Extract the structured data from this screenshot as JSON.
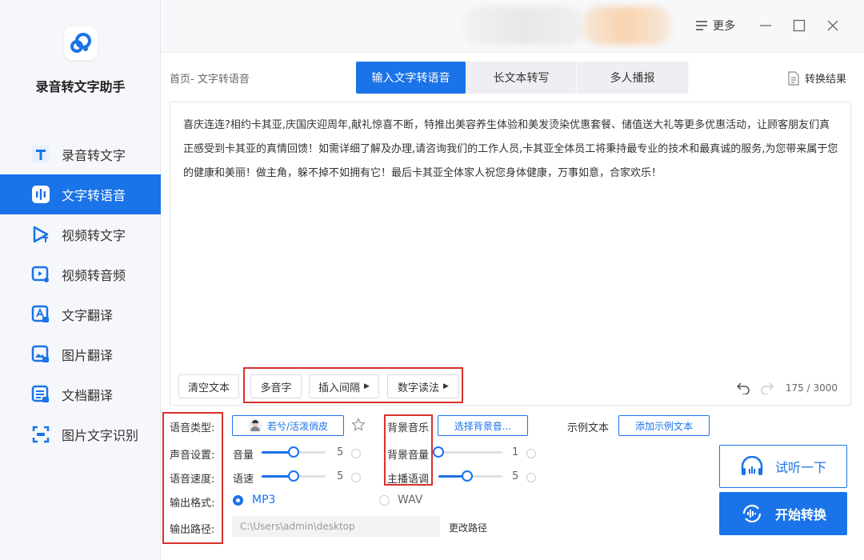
{
  "app": {
    "name": "录音转文字助手"
  },
  "sidebar": {
    "items": [
      {
        "label": "录音转文字",
        "icon": "text-t-icon"
      },
      {
        "label": "文字转语音",
        "icon": "audio-wave-icon",
        "active": true
      },
      {
        "label": "视频转文字",
        "icon": "video-play-icon"
      },
      {
        "label": "视频转音频",
        "icon": "video-audio-icon"
      },
      {
        "label": "文字翻译",
        "icon": "translate-text-icon"
      },
      {
        "label": "图片翻译",
        "icon": "image-translate-icon"
      },
      {
        "label": "文档翻译",
        "icon": "document-translate-icon"
      },
      {
        "label": "图片文字识别",
        "icon": "scan-icon"
      }
    ]
  },
  "topbar": {
    "more_label": "更多"
  },
  "breadcrumb": "首页- 文字转语音",
  "tabs": [
    {
      "label": "输入文字转语音",
      "active": true
    },
    {
      "label": "长文本转写"
    },
    {
      "label": "多人播报"
    }
  ],
  "result_label": "转换结果",
  "editor": {
    "text": "喜庆连连?相约卡其亚,庆国庆迎周年,献礼惊喜不断，特推出美容养生体验和美发烫染优惠套餐、储值送大礼等更多优惠活动，让顾客朋友们真正感受到卡其亚的真情回馈！如需详细了解及办理,请咨询我们的工作人员,卡其亚全体员工将秉持最专业的技术和最真诚的服务,为您带来属于您的健康和美丽！做主角，躲不掉不如拥有它！最后卡其亚全体家人祝您身体健康，万事如意，合家欢乐！",
    "clear_label": "清空文本",
    "polyphone_label": "多音字",
    "insert_pause_label": "插入间隔",
    "number_reading_label": "数字读法",
    "counter": "175 / 3000"
  },
  "settings": {
    "voice_type_label": "语音类型:",
    "voice_name": "若兮/活泼俏皮",
    "sound_settings_label": "声音设置:",
    "volume_label": "音量",
    "volume_value": "5",
    "volume_fraction": 0.5,
    "speed_label_left": "语音速度:",
    "speed_label": "语速",
    "speed_value": "5",
    "speed_fraction": 0.5,
    "output_format_label": "输出格式:",
    "format_mp3": "MP3",
    "format_wav": "WAV",
    "output_path_label": "输出路径:",
    "output_path": "C:\\Users\\admin\\desktop",
    "change_path_label": "更改路径",
    "bg_music_label": "背景音乐",
    "select_bg_label": "选择背景音...",
    "bg_volume_label": "背景音量",
    "bg_volume_value": "1",
    "bg_volume_fraction": 0.0,
    "pitch_label": "主播语调",
    "pitch_value": "5",
    "pitch_fraction": 0.45,
    "sample_text_label": "示例文本",
    "add_sample_label": "添加示例文本"
  },
  "actions": {
    "listen_label": "试听一下",
    "start_label": "开始转换"
  },
  "colors": {
    "accent": "#1a73e8",
    "highlight": "#d9302c"
  }
}
